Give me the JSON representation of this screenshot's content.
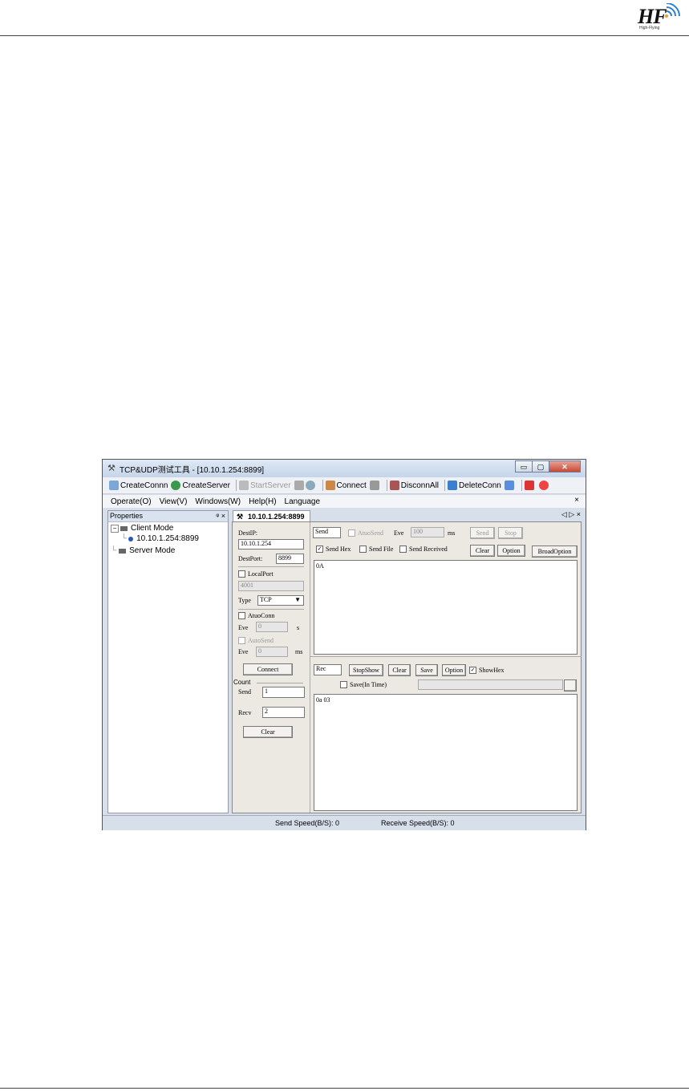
{
  "page": {
    "logo_text": "HF",
    "logo_subtext": "High-Flying"
  },
  "window": {
    "title": "TCP&UDP测试工具 - [10.10.1.254:8899]",
    "min_glyph": "▭",
    "max_glyph": "▢",
    "close_glyph": "✕"
  },
  "toolbar": {
    "create_conn": "CreateConnn",
    "create_server": "CreateServer",
    "start_server": "StartServer",
    "connect": "Connect",
    "disconn_all": "DisconnAll",
    "delete_conn": "DeleteConn"
  },
  "menu": {
    "items": [
      "Operate(O)",
      "View(V)",
      "Windows(W)",
      "Help(H)",
      "Language"
    ],
    "close": "×"
  },
  "properties": {
    "title": "Properties",
    "pin": "ᵠ ×",
    "client_mode": "Client Mode",
    "connection": "10.10.1.254:8899",
    "server_mode": "Server Mode",
    "expand_glyph": "−",
    "collapse_glyph": "+"
  },
  "tab": {
    "label": "10.10.1.254:8899",
    "controls": "◁ ▷ ×"
  },
  "left_form": {
    "dest_ip_label": "DestIP:",
    "dest_ip": "10.10.1.254",
    "dest_port_label": "DestPort:",
    "dest_port": "8899",
    "local_port_label": "LocalPort",
    "local_port": "4001",
    "type_label": "Type",
    "type_value": "TCP",
    "auto_conn_label": "AtuoConn",
    "eve1_label": "Eve",
    "eve1_value": "0",
    "eve1_unit": "s",
    "auto_send_label": "AutoSend",
    "eve2_label": "Eve",
    "eve2_value": "0",
    "eve2_unit": "ms",
    "connect_button": "Connect",
    "count_label": "Count",
    "send_label": "Send",
    "send_count": "1",
    "recv_label": "Recv",
    "recv_count": "2",
    "clear_button": "Clear"
  },
  "send_panel": {
    "send_box": "Send",
    "auto_send_label": "AtuoSend",
    "eve_label": "Eve",
    "eve_value": "100",
    "eve_unit": "ms",
    "send_button": "Send",
    "stop_button": "Stop",
    "send_hex_label": "Send Hex",
    "send_file_label": "Send File",
    "send_received_label": "Send Received",
    "clear_button": "Clear",
    "option_button": "Option",
    "broad_option_button": "BroadOption",
    "content": "0A",
    "check_glyph": "✓"
  },
  "recv_panel": {
    "rec_box": "Rec",
    "stop_show_button": "StopShow",
    "clear_button": "Clear",
    "save_button": "Save",
    "option_button": "Option",
    "show_hex_label": "ShowHex",
    "save_in_time_label": "Save(In Time)",
    "content": "0a 03"
  },
  "status": {
    "send_speed": "Send Speed(B/S): 0",
    "receive_speed": "Receive Speed(B/S): 0"
  }
}
